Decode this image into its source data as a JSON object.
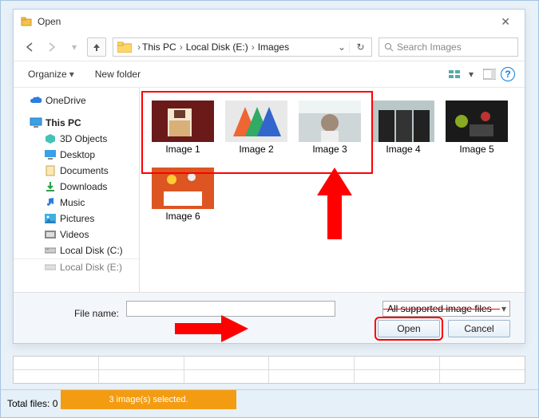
{
  "title": "Open",
  "breadcrumbs": [
    "This PC",
    "Local Disk (E:)",
    "Images"
  ],
  "search": {
    "placeholder": "Search Images"
  },
  "toolbar": {
    "organize": "Organize",
    "newfolder": "New folder"
  },
  "tree": {
    "onedrive": "OneDrive",
    "thispc": "This PC",
    "items": [
      "3D Objects",
      "Desktop",
      "Documents",
      "Downloads",
      "Music",
      "Pictures",
      "Videos",
      "Local Disk (C:)",
      "Local Disk (E:)"
    ]
  },
  "thumbs": [
    {
      "label": "Image 1"
    },
    {
      "label": "Image 2"
    },
    {
      "label": "Image 3"
    },
    {
      "label": "Image 4"
    },
    {
      "label": "Image 5"
    },
    {
      "label": "Image 6"
    }
  ],
  "filename_label": "File name:",
  "filter": "All supported image files",
  "buttons": {
    "open": "Open",
    "cancel": "Cancel"
  },
  "status": {
    "total": "Total files:  0",
    "selection": "3 image(s) selected."
  }
}
